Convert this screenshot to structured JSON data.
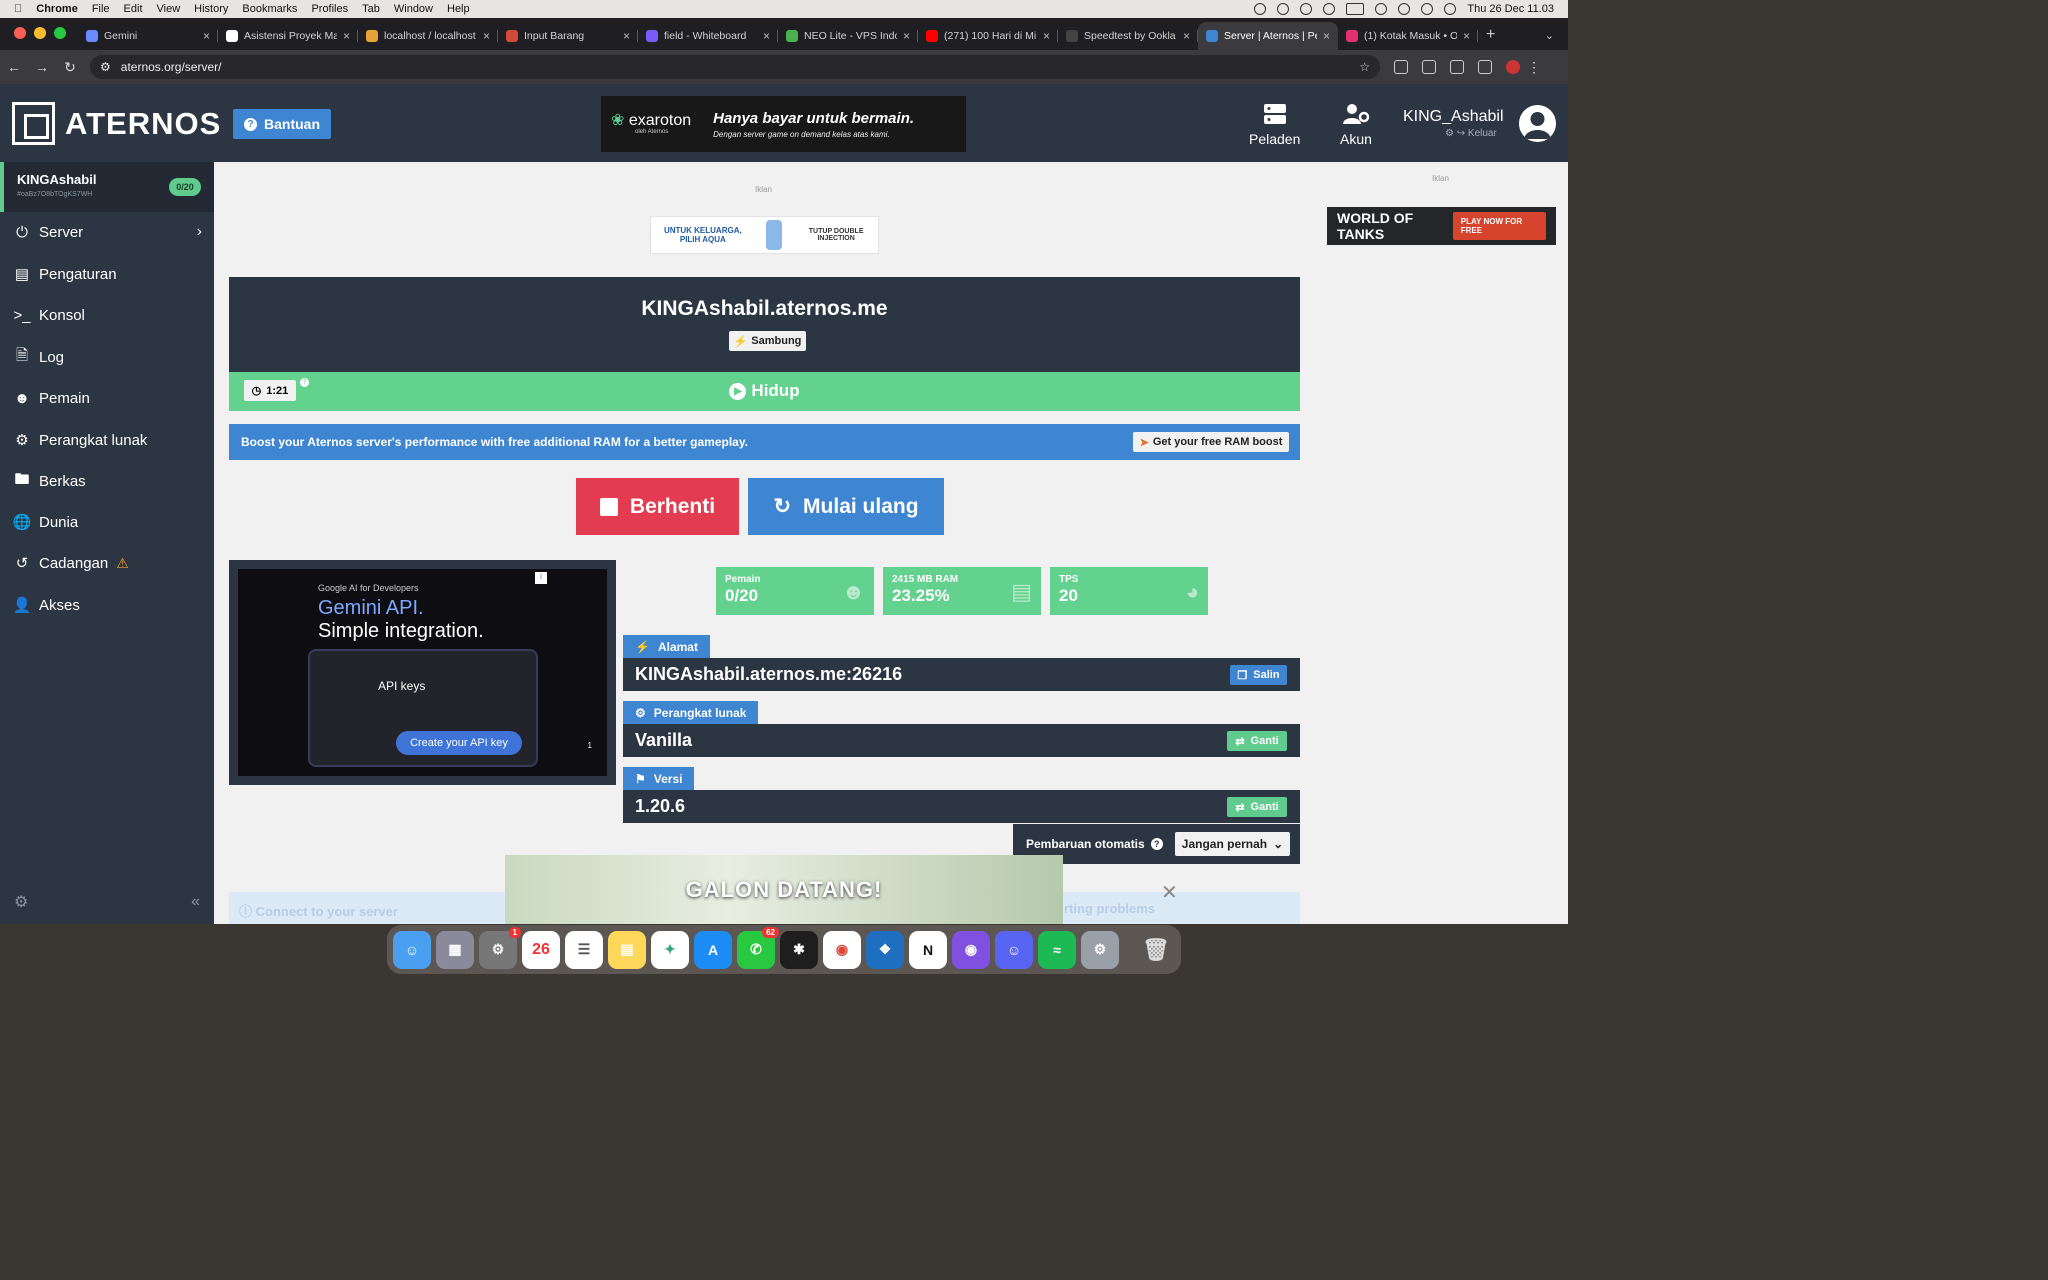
{
  "menubar": {
    "app": "Chrome",
    "items": [
      "File",
      "Edit",
      "View",
      "History",
      "Bookmarks",
      "Profiles",
      "Tab",
      "Window",
      "Help"
    ],
    "clock": "Thu 26 Dec  11.03"
  },
  "tabs": [
    {
      "label": "Gemini",
      "color": "#6b8cff",
      "active": false
    },
    {
      "label": "Asistensi Proyek Ma",
      "color": "#ffffff",
      "active": false
    },
    {
      "label": "localhost / localhost",
      "color": "#e8a23a",
      "active": false
    },
    {
      "label": "Input Barang",
      "color": "#d24a3a",
      "active": false
    },
    {
      "label": "field - Whiteboard",
      "color": "#7a5af8",
      "active": false
    },
    {
      "label": "NEO Lite - VPS Indo",
      "color": "#4caf50",
      "active": false
    },
    {
      "label": "(271) 100 Hari di Mi",
      "color": "#ff0000",
      "active": false
    },
    {
      "label": "Speedtest by Ookla",
      "color": "#444",
      "active": false
    },
    {
      "label": "Server | Aternos | Pe",
      "color": "#3e86d1",
      "active": true
    },
    {
      "label": "(1) Kotak Masuk • O",
      "color": "#e1306c",
      "active": false
    }
  ],
  "url": "aternos.org/server/",
  "header": {
    "logo": "ATERNOS",
    "help": "Bantuan",
    "ad_brand": "exaroton",
    "ad_brand_sub": "oleh Aternos",
    "ad_headline": "Hanya bayar untuk bermain.",
    "ad_sub": "Dengan server game on demand kelas atas kami.",
    "nav_servers": "Peladen",
    "nav_account": "Akun",
    "username": "KING_Ashabil",
    "logout": "Keluar"
  },
  "sidebar": {
    "server_name": "KINGAshabil",
    "server_id": "#oaBz7O8bTOgKS7WH",
    "players_badge": "0/20",
    "items": [
      {
        "label": "Server",
        "icon": "power-icon"
      },
      {
        "label": "Pengaturan",
        "icon": "sliders-icon"
      },
      {
        "label": "Konsol",
        "icon": "terminal-icon"
      },
      {
        "label": "Log",
        "icon": "file-icon"
      },
      {
        "label": "Pemain",
        "icon": "users-icon"
      },
      {
        "label": "Perangkat lunak",
        "icon": "gears-icon"
      },
      {
        "label": "Berkas",
        "icon": "folder-icon"
      },
      {
        "label": "Dunia",
        "icon": "globe-icon"
      },
      {
        "label": "Cadangan",
        "icon": "history-icon"
      },
      {
        "label": "Akses",
        "icon": "user-lock-icon"
      }
    ]
  },
  "ads": {
    "label": "Iklan",
    "aqua_left": "UNTUK KELUARGA, PILIH AQUA",
    "aqua_right": "TUTUP DOUBLE INJECTION",
    "wot_title": "WORLD OF TANKS",
    "wot_cta": "PLAY NOW FOR FREE",
    "gemini_kicker": "Google AI for Developers",
    "gemini_title": "Gemini API.",
    "gemini_sub": "Simple integration.",
    "gemini_keys": "API keys",
    "gemini_cta": "Create your API key",
    "gemini_num": "1",
    "galon": "GALON DATANG!"
  },
  "server": {
    "address": "KINGAshabil.aternos.me",
    "connect": "Sambung",
    "timer": "1:21",
    "status": "Hidup",
    "ram_banner": "Boost your Aternos server's performance with free additional RAM for a better gameplay.",
    "ram_button": "Get your free RAM boost",
    "stop": "Berhenti",
    "restart": "Mulai ulang"
  },
  "stats": [
    {
      "label": "Pemain",
      "value": "0/20",
      "icon": "users-icon"
    },
    {
      "label": "2415 MB RAM",
      "value": "23.25%",
      "icon": "memory-icon"
    },
    {
      "label": "TPS",
      "value": "20",
      "icon": "gauge-icon"
    }
  ],
  "info": {
    "address_label": "Alamat",
    "address_value": "KINGAshabil.aternos.me:26216",
    "copy": "Salin",
    "software_label": "Perangkat lunak",
    "software_value": "Vanilla",
    "change": "Ganti",
    "version_label": "Versi",
    "version_value": "1.20.6",
    "auto_update": "Pembaruan otomatis",
    "auto_update_value": "Jangan pernah"
  },
  "bottom": {
    "connect_help": "Connect to your server",
    "trouble": "rting problems"
  }
}
